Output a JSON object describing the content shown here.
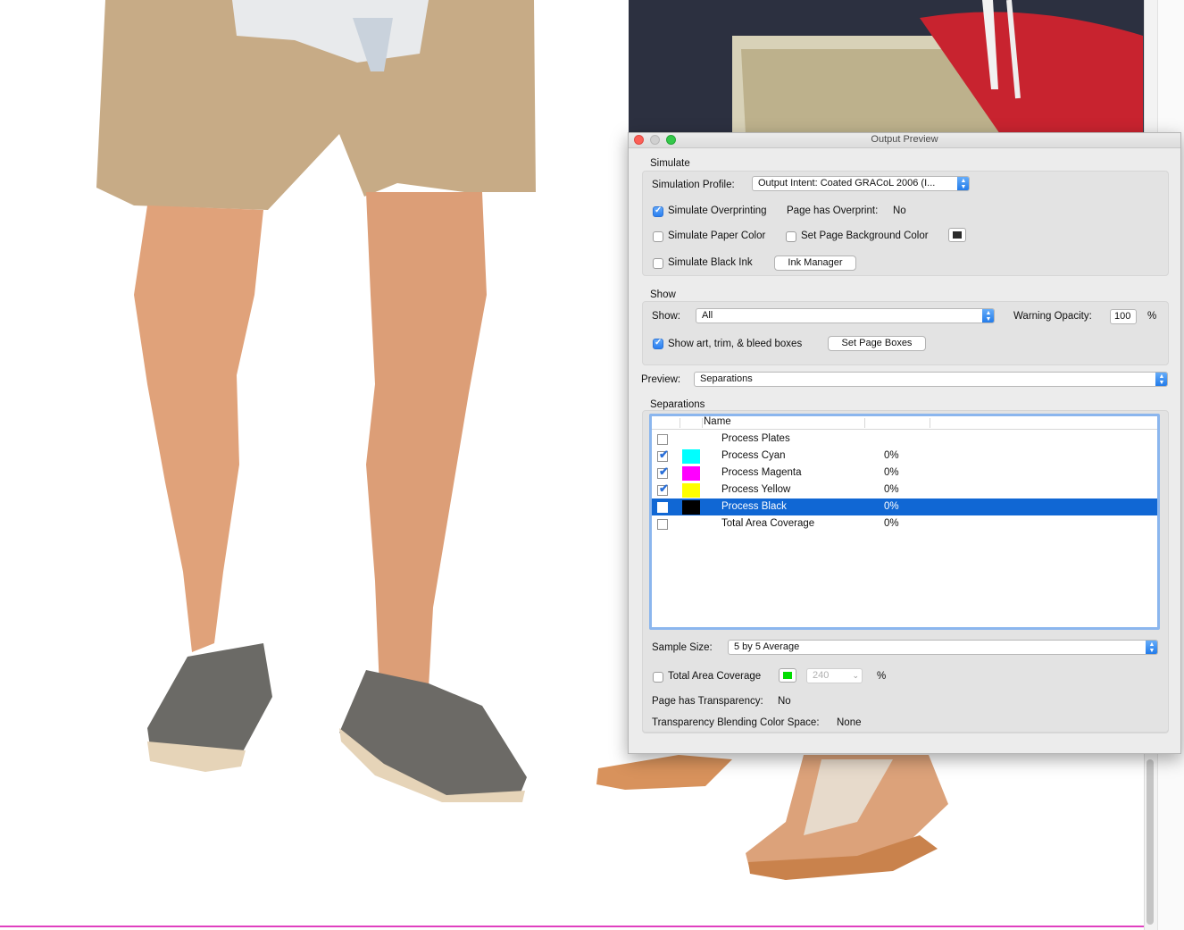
{
  "window": {
    "title": "Output Preview"
  },
  "simulate": {
    "heading": "Simulate",
    "profile_label": "Simulation Profile:",
    "profile_value": "Output Intent: Coated GRACoL 2006 (I...",
    "overprinting_label": "Simulate Overprinting",
    "overprinting_checked": true,
    "page_overprint_label": "Page has Overprint:",
    "page_overprint_value": "No",
    "paper_color_label": "Simulate Paper Color",
    "paper_color_checked": false,
    "bg_color_label": "Set Page Background Color",
    "bg_color_checked": false,
    "bg_color_swatch": "#2b2b2b",
    "black_ink_label": "Simulate Black Ink",
    "black_ink_checked": false,
    "ink_manager_label": "Ink Manager"
  },
  "show": {
    "heading": "Show",
    "show_label": "Show:",
    "show_value": "All",
    "warning_opacity_label": "Warning Opacity:",
    "warning_opacity_value": "100",
    "percent": "%",
    "boxes_label": "Show art, trim, & bleed boxes",
    "boxes_checked": true,
    "set_page_boxes_label": "Set Page Boxes"
  },
  "preview": {
    "label": "Preview:",
    "value": "Separations"
  },
  "separations": {
    "heading": "Separations",
    "name_header": "Name",
    "rows": [
      {
        "name": "Process Plates",
        "value": "",
        "swatch": "",
        "checked": false,
        "selected": false
      },
      {
        "name": "Process Cyan",
        "value": "0%",
        "swatch": "#00ffff",
        "checked": true,
        "selected": false
      },
      {
        "name": "Process Magenta",
        "value": "0%",
        "swatch": "#ff00ff",
        "checked": true,
        "selected": false
      },
      {
        "name": "Process Yellow",
        "value": "0%",
        "swatch": "#ffff00",
        "checked": true,
        "selected": false
      },
      {
        "name": "Process Black",
        "value": "0%",
        "swatch": "#000000",
        "checked": false,
        "selected": true
      },
      {
        "name": "Total Area Coverage",
        "value": "0%",
        "swatch": "",
        "checked": false,
        "selected": false
      }
    ]
  },
  "sample": {
    "label": "Sample Size:",
    "value": "5 by 5 Average"
  },
  "coverage": {
    "label": "Total Area Coverage",
    "checked": false,
    "swatch": "#00dd00",
    "value": "240",
    "percent": "%"
  },
  "transparency": {
    "page_label": "Page has Transparency:",
    "page_value": "No",
    "blend_label": "Transparency Blending Color Space:",
    "blend_value": "None"
  }
}
